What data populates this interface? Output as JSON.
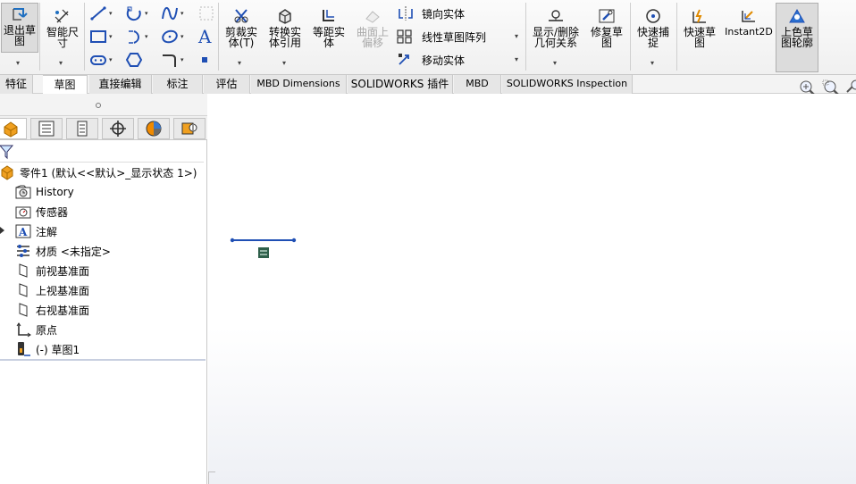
{
  "ribbon": {
    "exit_sketch": "退出草\n图",
    "smart_dim": "智能尺\n寸",
    "trim": "剪裁实\n体(T)",
    "convert": "转换实\n体引用",
    "offset": "等距实\n体",
    "surface_offset": "曲面上\n偏移",
    "mirror": "镜向实体",
    "linear_pattern": "线性草图阵列",
    "move": "移动实体",
    "display_relations": "显示/删除\n几何关系",
    "repair": "修复草\n图",
    "quick_snap": "快速捕\n捉",
    "rapid_sketch": "快速草\n图",
    "instant2d": "Instant2D",
    "shaded_contour": "上色草\n图轮廓"
  },
  "tabs": [
    {
      "label": "特征"
    },
    {
      "label": "草图"
    },
    {
      "label": "直接编辑"
    },
    {
      "label": "标注"
    },
    {
      "label": "评估"
    },
    {
      "label": "MBD Dimensions"
    },
    {
      "label": "SOLIDWORKS 插件"
    },
    {
      "label": "MBD"
    },
    {
      "label": "SOLIDWORKS Inspection"
    }
  ],
  "tree": {
    "root": "零件1  (默认<<默认>_显示状态 1>)",
    "items": [
      {
        "label": "History"
      },
      {
        "label": "传感器"
      },
      {
        "label": "注解"
      },
      {
        "label": "材质 <未指定>"
      },
      {
        "label": "前视基准面"
      },
      {
        "label": "上视基准面"
      },
      {
        "label": "右视基准面"
      },
      {
        "label": "原点"
      },
      {
        "label": "(-) 草图1"
      }
    ]
  },
  "colors": {
    "accent": "#1f4fb4",
    "active_tool_bg": "#dcdcdc"
  }
}
